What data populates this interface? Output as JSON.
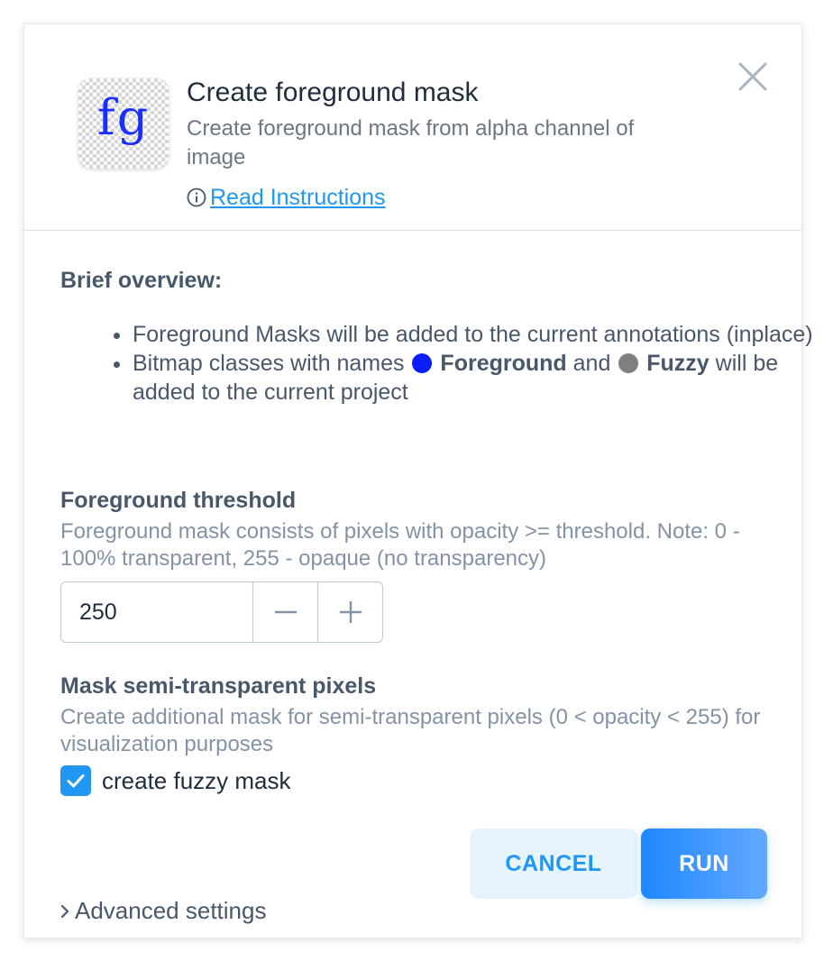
{
  "app": {
    "icon_text": "fg",
    "title": "Create foreground mask",
    "subtitle": "Create foreground mask from alpha channel of image",
    "read_instructions": "Read Instructions"
  },
  "overview": {
    "title": "Brief overview:",
    "bullet1": "Foreground Masks will be added to the current annotations (inplace)",
    "bullet2_prefix": "Bitmap classes with names",
    "class_foreground": "Foreground",
    "and": "and",
    "class_fuzzy": "Fuzzy",
    "bullet2_suffix": "will be added to the current project"
  },
  "threshold": {
    "title": "Foreground threshold",
    "description": "Foreground mask consists of pixels with opacity >= threshold. Note: 0 - 100% transparent, 255 - opaque (no transparency)",
    "value": "250"
  },
  "mask": {
    "title": "Mask semi-transparent pixels",
    "description": "Create additional mask for semi-transparent pixels (0 < opacity < 255) for visualization purposes",
    "checkbox_label": "create fuzzy mask",
    "checked": true
  },
  "buttons": {
    "cancel": "CANCEL",
    "run": "RUN"
  },
  "advanced": {
    "label": "Advanced settings"
  },
  "colors": {
    "accent": "#2196f3",
    "foreground_class": "#0a1eff",
    "fuzzy_class": "#808080"
  },
  "icons": {
    "close": "close-icon",
    "info": "info-icon",
    "minus": "minus-icon",
    "plus": "plus-icon",
    "check": "check-icon",
    "chevron": "chevron-right-icon"
  }
}
